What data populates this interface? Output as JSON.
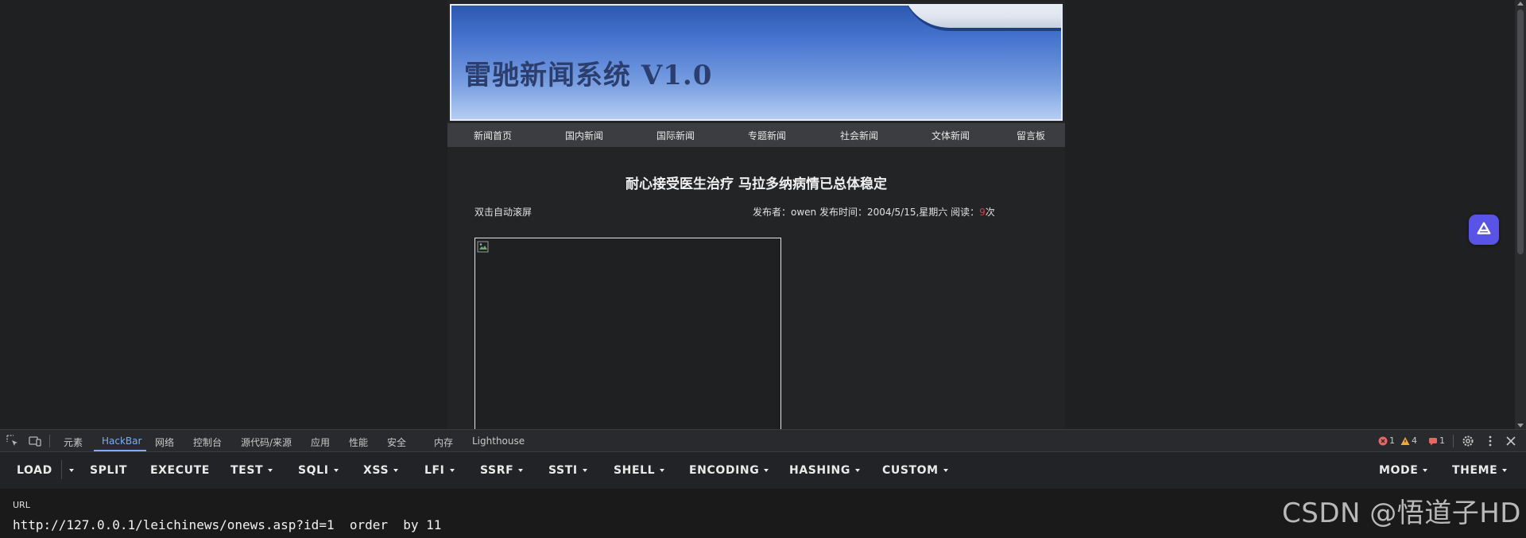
{
  "site": {
    "banner_title": "雷驰新闻系统 V1.0",
    "nav": [
      "新闻首页",
      "国内新闻",
      "国际新闻",
      "专题新闻",
      "社会新闻",
      "文体新闻",
      "留言板"
    ],
    "headline": "耐心接受医生治疗 马拉多纳病情已总体稳定",
    "autoscroll": "双击自动滚屏",
    "meta_prefix": "发布者：owen 发布时间：2004/5/15,星期六 阅读：",
    "reads": "9",
    "reads_suffix": "次"
  },
  "devtools": {
    "tabs": [
      "元素",
      "HackBar",
      "网络",
      "控制台",
      "源代码/来源",
      "应用",
      "性能",
      "安全",
      "内存",
      "Lighthouse"
    ],
    "active_tab": "HackBar",
    "errors": "1",
    "warnings": "4",
    "issues": "1"
  },
  "hackbar": {
    "buttons": [
      "LOAD",
      "SPLIT",
      "EXECUTE",
      "TEST",
      "SQLI",
      "XSS",
      "LFI",
      "SSRF",
      "SSTI",
      "SHELL",
      "ENCODING",
      "HASHING",
      "CUSTOM"
    ],
    "right_buttons": [
      "MODE",
      "THEME"
    ],
    "url_label": "URL",
    "url_value": "http://127.0.0.1/leichinews/onews.asp?id=1  order  by 11"
  },
  "watermark": "CSDN @悟道子HD",
  "colors": {
    "accent": "#7cacf8",
    "float_button": "#5a54e6",
    "reads_count": "#e03c3c"
  }
}
